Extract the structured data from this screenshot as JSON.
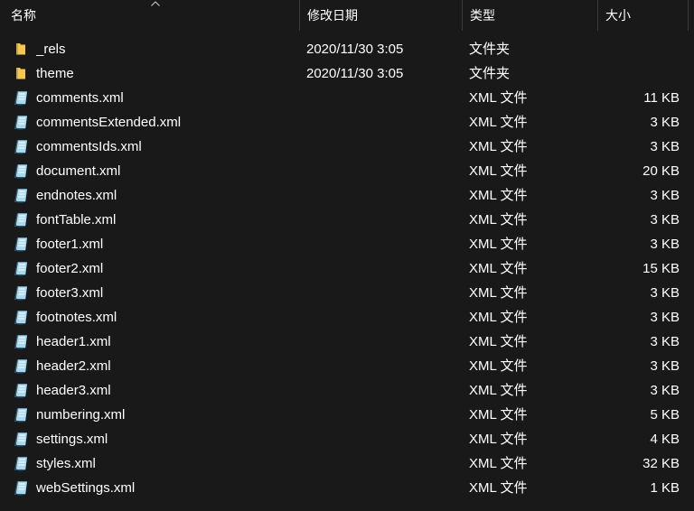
{
  "columns": {
    "name": "名称",
    "date": "修改日期",
    "type": "类型",
    "size": "大小"
  },
  "colors": {
    "background": "#191919",
    "folder": "#f5c94e",
    "xml_icon": "#a9d9ec"
  },
  "files": [
    {
      "name": "_rels",
      "date": "2020/11/30 3:05",
      "type": "文件夹",
      "size": "",
      "icon": "folder-icon"
    },
    {
      "name": "theme",
      "date": "2020/11/30 3:05",
      "type": "文件夹",
      "size": "",
      "icon": "folder-icon"
    },
    {
      "name": "comments.xml",
      "date": "",
      "type": "XML 文件",
      "size": "11 KB",
      "icon": "xml-file-icon"
    },
    {
      "name": "commentsExtended.xml",
      "date": "",
      "type": "XML 文件",
      "size": "3 KB",
      "icon": "xml-file-icon"
    },
    {
      "name": "commentsIds.xml",
      "date": "",
      "type": "XML 文件",
      "size": "3 KB",
      "icon": "xml-file-icon"
    },
    {
      "name": "document.xml",
      "date": "",
      "type": "XML 文件",
      "size": "20 KB",
      "icon": "xml-file-icon"
    },
    {
      "name": "endnotes.xml",
      "date": "",
      "type": "XML 文件",
      "size": "3 KB",
      "icon": "xml-file-icon"
    },
    {
      "name": "fontTable.xml",
      "date": "",
      "type": "XML 文件",
      "size": "3 KB",
      "icon": "xml-file-icon"
    },
    {
      "name": "footer1.xml",
      "date": "",
      "type": "XML 文件",
      "size": "3 KB",
      "icon": "xml-file-icon"
    },
    {
      "name": "footer2.xml",
      "date": "",
      "type": "XML 文件",
      "size": "15 KB",
      "icon": "xml-file-icon"
    },
    {
      "name": "footer3.xml",
      "date": "",
      "type": "XML 文件",
      "size": "3 KB",
      "icon": "xml-file-icon"
    },
    {
      "name": "footnotes.xml",
      "date": "",
      "type": "XML 文件",
      "size": "3 KB",
      "icon": "xml-file-icon"
    },
    {
      "name": "header1.xml",
      "date": "",
      "type": "XML 文件",
      "size": "3 KB",
      "icon": "xml-file-icon"
    },
    {
      "name": "header2.xml",
      "date": "",
      "type": "XML 文件",
      "size": "3 KB",
      "icon": "xml-file-icon"
    },
    {
      "name": "header3.xml",
      "date": "",
      "type": "XML 文件",
      "size": "3 KB",
      "icon": "xml-file-icon"
    },
    {
      "name": "numbering.xml",
      "date": "",
      "type": "XML 文件",
      "size": "5 KB",
      "icon": "xml-file-icon"
    },
    {
      "name": "settings.xml",
      "date": "",
      "type": "XML 文件",
      "size": "4 KB",
      "icon": "xml-file-icon"
    },
    {
      "name": "styles.xml",
      "date": "",
      "type": "XML 文件",
      "size": "32 KB",
      "icon": "xml-file-icon"
    },
    {
      "name": "webSettings.xml",
      "date": "",
      "type": "XML 文件",
      "size": "1 KB",
      "icon": "xml-file-icon"
    }
  ]
}
